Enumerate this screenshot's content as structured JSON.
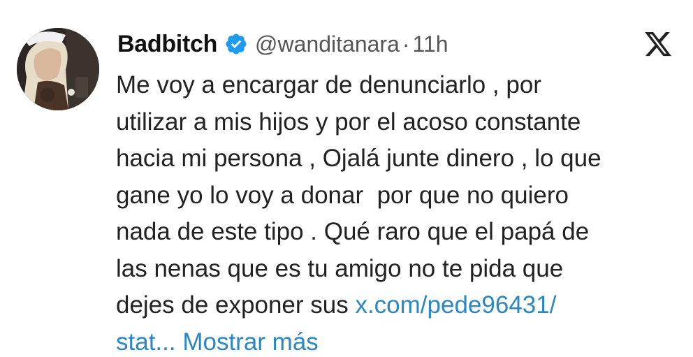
{
  "user": {
    "display_name": "Badbitch",
    "handle": "@wanditanara",
    "separator": "·",
    "timestamp": "11h",
    "verified_icon": "verified-badge-icon",
    "avatar": "profile-photo"
  },
  "platform_icon": "x-logo-icon",
  "tweet": {
    "lines": [
      "Me voy a encargar de denunciarlo , por",
      "utilizar a mis hijos y por el acoso constante",
      "hacia mi persona , Ojalá junte dinero , lo que",
      "gane yo lo voy a donar  por que no quiero",
      "nada de este tipo . Qué raro que el papá de",
      "las nenas que es tu amigo no te pida que"
    ],
    "last_line_text": "dejes de exponer sus ",
    "link_part1": "x.com/pede96431/",
    "link_part2": "stat...",
    "show_more": " Mostrar más"
  },
  "colors": {
    "link": "#2b87c4",
    "verified": "#1d9bf0",
    "text": "#222222",
    "meta": "#555555"
  }
}
